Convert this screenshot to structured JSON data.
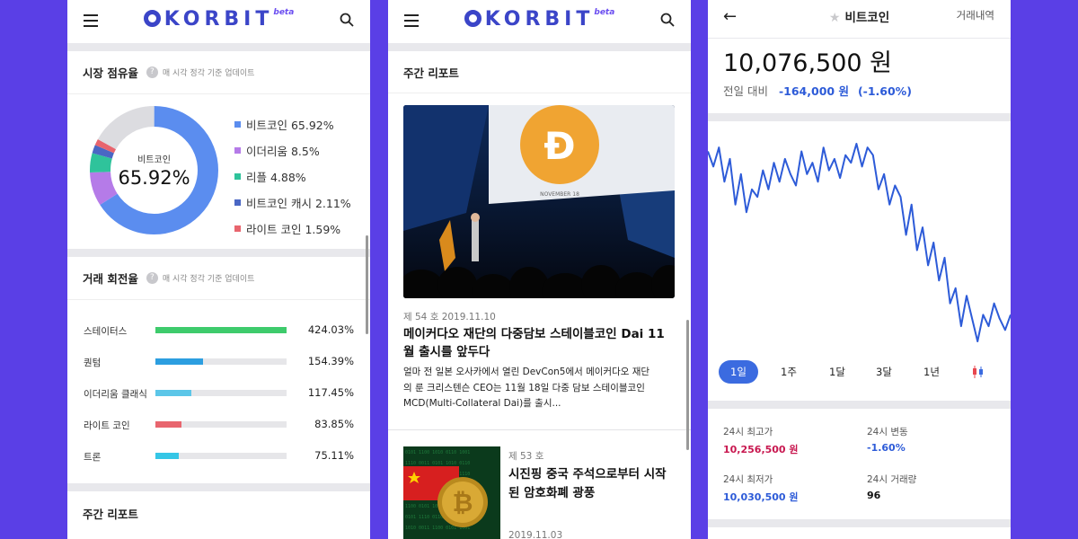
{
  "brand": {
    "name": "KORBIT",
    "badge": "beta"
  },
  "market_share": {
    "title": "시장 점유율",
    "help": "?",
    "hint": "매 시각 정각 기준 업데이트",
    "center_label": "비트코인",
    "center_value": "65.92%",
    "legend": [
      {
        "label": "비트코인 65.92%",
        "percent": 65.92,
        "color": "#5b8def"
      },
      {
        "label": "이더리움 8.5%",
        "percent": 8.5,
        "color": "#b57be8"
      },
      {
        "label": "리플 4.88%",
        "percent": 4.88,
        "color": "#2fc39b"
      },
      {
        "label": "비트코인 캐시 2.11%",
        "percent": 2.11,
        "color": "#4a67c4"
      },
      {
        "label": "라이트 코인 1.59%",
        "percent": 1.59,
        "color": "#e8656e"
      }
    ],
    "rest_color": "#dcdce0"
  },
  "turnover": {
    "title": "거래 회전율",
    "help": "?",
    "hint": "매 시각 정각 기준 업데이트",
    "rows": [
      {
        "name": "스테이터스",
        "value": "424.03%",
        "percent": 424.03,
        "color": "#3ecb6c"
      },
      {
        "name": "퀀텀",
        "value": "154.39%",
        "percent": 154.39,
        "color": "#2c9ee0"
      },
      {
        "name": "이더리움 클래식",
        "value": "117.45%",
        "percent": 117.45,
        "color": "#5cc6e8"
      },
      {
        "name": "라이트 코인",
        "value": "83.85%",
        "percent": 83.85,
        "color": "#e8656e"
      },
      {
        "name": "트론",
        "value": "75.11%",
        "percent": 75.11,
        "color": "#35c6e6"
      }
    ]
  },
  "weekly_report": {
    "section_title": "주간 리포트",
    "items": [
      {
        "meta": "제 54 호  2019.11.10",
        "title_lines": [
          "메이커다오 재단의 다중담보 스테이블코인 Dai 11",
          "월 출시를 앞두다"
        ],
        "body_lines": [
          "얼마 전 일본 오사카에서 열린 DevCon5에서 메이커다오 재단",
          "의 룬 크리스텐슨 CEO는 11월 18일 다중 담보 스테이블코인",
          "MCD(Multi-Collateral Dai)를 출시..."
        ],
        "image_caption": "NOVEMBER 18"
      },
      {
        "meta": "제 53 호",
        "title_lines": [
          "시진핑 중국 주석으로부터 시작",
          "된 암호화폐 광풍"
        ],
        "date": "2019.11.03"
      }
    ]
  },
  "coin": {
    "back": "←",
    "star": "★",
    "name": "비트코인",
    "history_link": "거래내역",
    "price": "10,076,500 원",
    "change_label": "전일 대비",
    "change_value": "-164,000 원",
    "change_percent": "(-1.60%)",
    "line_color": "#2d5bd8",
    "ranges": [
      "1일",
      "1주",
      "1달",
      "3달",
      "1년"
    ],
    "selected_range": "1일",
    "stats": {
      "high_label": "24시 최고가",
      "high_value": "10,256,500 원",
      "high_color": "#c8174f",
      "change_label": "24시 변동",
      "change_value": "-1.60%",
      "change_color": "#2d5bd8",
      "low_label": "24시 최저가",
      "low_value": "10,030,500 원",
      "low_color": "#2d5bd8",
      "volume_label": "24시 거래량",
      "volume_value": "96",
      "volume_color": "#111"
    }
  },
  "chart_data": {
    "type": "line",
    "title": "",
    "xlabel": "",
    "ylabel": "",
    "series": [
      {
        "values": [
          10190,
          10170,
          10195,
          10150,
          10180,
          10120,
          10160,
          10110,
          10140,
          10130,
          10165,
          10140,
          10175,
          10150,
          10180,
          10160,
          10145,
          10190,
          10160,
          10175,
          10150,
          10195,
          10165,
          10180,
          10155,
          10185,
          10175,
          10200,
          10170,
          10195,
          10185,
          10140,
          10160,
          10120,
          10145,
          10130,
          10080,
          10120,
          10060,
          10090,
          10040,
          10070,
          10020,
          10050,
          9990,
          10010,
          9960,
          10000,
          9970,
          9940,
          9975,
          9960,
          9990,
          9970,
          9955,
          9975
        ]
      }
    ]
  }
}
